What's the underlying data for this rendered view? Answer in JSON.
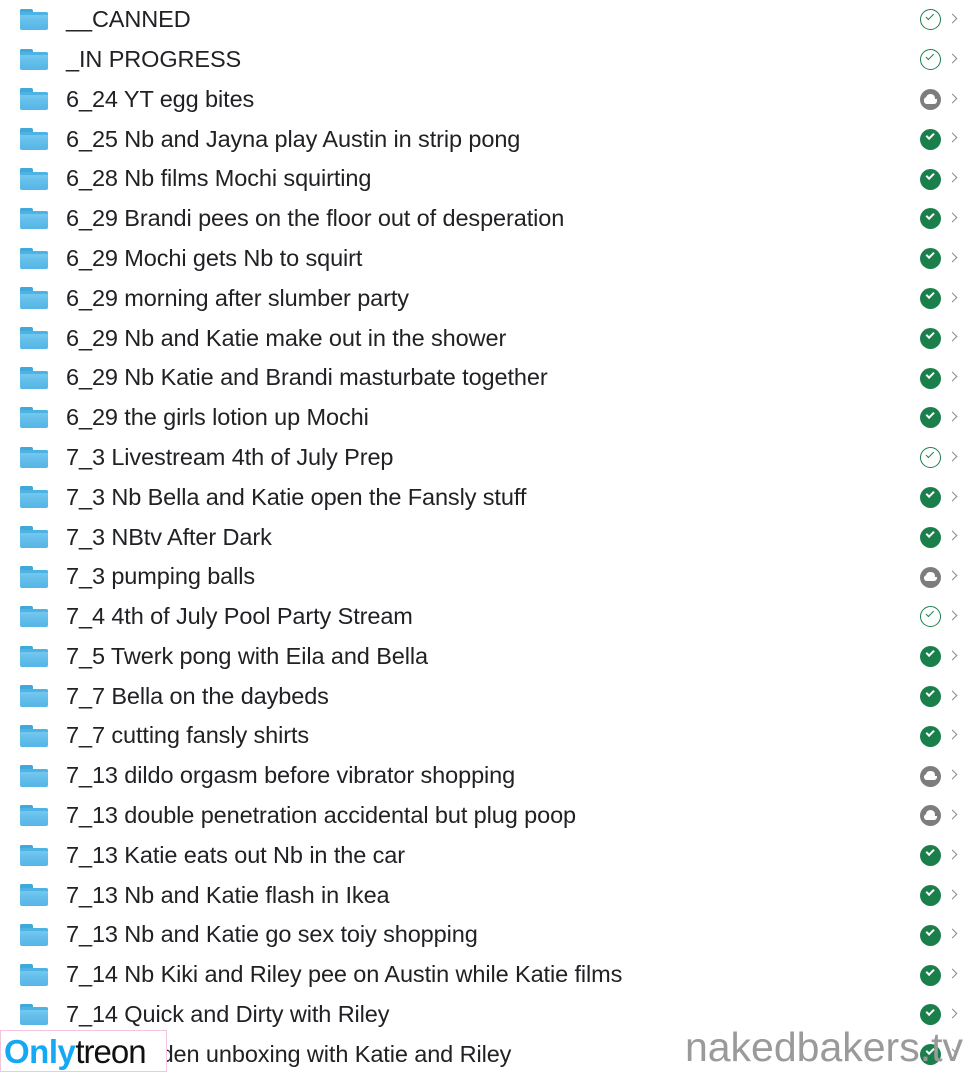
{
  "window": {
    "kind": "cloud-storage-folder-list",
    "background": "#ffffff",
    "text_color": "#202124",
    "folder_icon_color": "#62BDEA",
    "synced_color": "#1B7F4B",
    "cloud_color": "#7D7D7D",
    "chevron_color": "#8A8A8A"
  },
  "watermark": {
    "text": "nakedbakers.tv",
    "color": "#9A9A9A"
  },
  "logo": {
    "part_one": "Only",
    "part_two": "treon",
    "part_one_color": "#16A7F5",
    "part_two_color": "#111111"
  },
  "files": [
    {
      "name": "__CANNED",
      "icon": "folder-icon",
      "status": "synced-outline",
      "status_label": "available-online-and-offline",
      "chevron": "chevron-right-icon"
    },
    {
      "name": "_IN PROGRESS",
      "icon": "folder-icon",
      "status": "synced-outline",
      "status_label": "available-online-and-offline",
      "chevron": "chevron-right-icon"
    },
    {
      "name": "6_24 YT egg bites",
      "icon": "folder-icon",
      "status": "cloud",
      "status_label": "online-only",
      "chevron": "chevron-right-icon"
    },
    {
      "name": "6_25 Nb and Jayna play Austin in strip pong",
      "icon": "folder-icon",
      "status": "synced-filled",
      "status_label": "synced",
      "chevron": "chevron-right-icon"
    },
    {
      "name": "6_28 Nb films Mochi squirting",
      "icon": "folder-icon",
      "status": "synced-filled",
      "status_label": "synced",
      "chevron": "chevron-right-icon"
    },
    {
      "name": "6_29 Brandi pees on the floor out of desperation",
      "icon": "folder-icon",
      "status": "synced-filled",
      "status_label": "synced",
      "chevron": "chevron-right-icon"
    },
    {
      "name": "6_29 Mochi gets Nb to squirt",
      "icon": "folder-icon",
      "status": "synced-filled",
      "status_label": "synced",
      "chevron": "chevron-right-icon"
    },
    {
      "name": "6_29 morning after slumber party",
      "icon": "folder-icon",
      "status": "synced-filled",
      "status_label": "synced",
      "chevron": "chevron-right-icon"
    },
    {
      "name": "6_29 Nb and Katie make out in the shower",
      "icon": "folder-icon",
      "status": "synced-filled",
      "status_label": "synced",
      "chevron": "chevron-right-icon"
    },
    {
      "name": "6_29 Nb Katie and Brandi masturbate together",
      "icon": "folder-icon",
      "status": "synced-filled",
      "status_label": "synced",
      "chevron": "chevron-right-icon"
    },
    {
      "name": "6_29 the girls lotion up Mochi",
      "icon": "folder-icon",
      "status": "synced-filled",
      "status_label": "synced",
      "chevron": "chevron-right-icon"
    },
    {
      "name": "7_3 Livestream 4th of July Prep",
      "icon": "folder-icon",
      "status": "synced-outline",
      "status_label": "available-online-and-offline",
      "chevron": "chevron-right-icon"
    },
    {
      "name": "7_3 Nb Bella and Katie open the Fansly stuff",
      "icon": "folder-icon",
      "status": "synced-filled",
      "status_label": "synced",
      "chevron": "chevron-right-icon"
    },
    {
      "name": "7_3 NBtv After Dark",
      "icon": "folder-icon",
      "status": "synced-filled",
      "status_label": "synced",
      "chevron": "chevron-right-icon"
    },
    {
      "name": "7_3 pumping balls",
      "icon": "folder-icon",
      "status": "cloud",
      "status_label": "online-only",
      "chevron": "chevron-right-icon"
    },
    {
      "name": "7_4 4th of July Pool Party Stream",
      "icon": "folder-icon",
      "status": "synced-outline",
      "status_label": "available-online-and-offline",
      "chevron": "chevron-right-icon"
    },
    {
      "name": "7_5 Twerk pong with Eila and Bella",
      "icon": "folder-icon",
      "status": "synced-filled",
      "status_label": "synced",
      "chevron": "chevron-right-icon"
    },
    {
      "name": "7_7 Bella on the daybeds",
      "icon": "folder-icon",
      "status": "synced-filled",
      "status_label": "synced",
      "chevron": "chevron-right-icon"
    },
    {
      "name": "7_7 cutting fansly shirts",
      "icon": "folder-icon",
      "status": "synced-filled",
      "status_label": "synced",
      "chevron": "chevron-right-icon"
    },
    {
      "name": "7_13 dildo orgasm before vibrator shopping",
      "icon": "folder-icon",
      "status": "cloud",
      "status_label": "online-only",
      "chevron": "chevron-right-icon"
    },
    {
      "name": "7_13 double penetration accidental but plug poop",
      "icon": "folder-icon",
      "status": "cloud",
      "status_label": "online-only",
      "chevron": "chevron-right-icon"
    },
    {
      "name": "7_13 Katie eats out Nb in the car",
      "icon": "folder-icon",
      "status": "synced-filled",
      "status_label": "synced",
      "chevron": "chevron-right-icon"
    },
    {
      "name": "7_13 Nb and Katie flash in Ikea",
      "icon": "folder-icon",
      "status": "synced-filled",
      "status_label": "synced",
      "chevron": "chevron-right-icon"
    },
    {
      "name": "7_13 Nb and Katie go sex toiy shopping",
      "icon": "folder-icon",
      "status": "synced-filled",
      "status_label": "synced",
      "chevron": "chevron-right-icon"
    },
    {
      "name": "7_14 Nb Kiki and Riley pee on Austin while Katie films",
      "icon": "folder-icon",
      "status": "synced-filled",
      "status_label": "synced",
      "chevron": "chevron-right-icon"
    },
    {
      "name": "7_14 Quick and Dirty with Riley",
      "icon": "folder-icon",
      "status": "synced-filled",
      "status_label": "synced",
      "chevron": "chevron-right-icon"
    },
    {
      "name": "7_14 Golden unboxing with Katie and Riley",
      "icon": "folder-icon",
      "status": "synced-filled",
      "status_label": "synced",
      "chevron": "chevron-right-icon"
    }
  ]
}
